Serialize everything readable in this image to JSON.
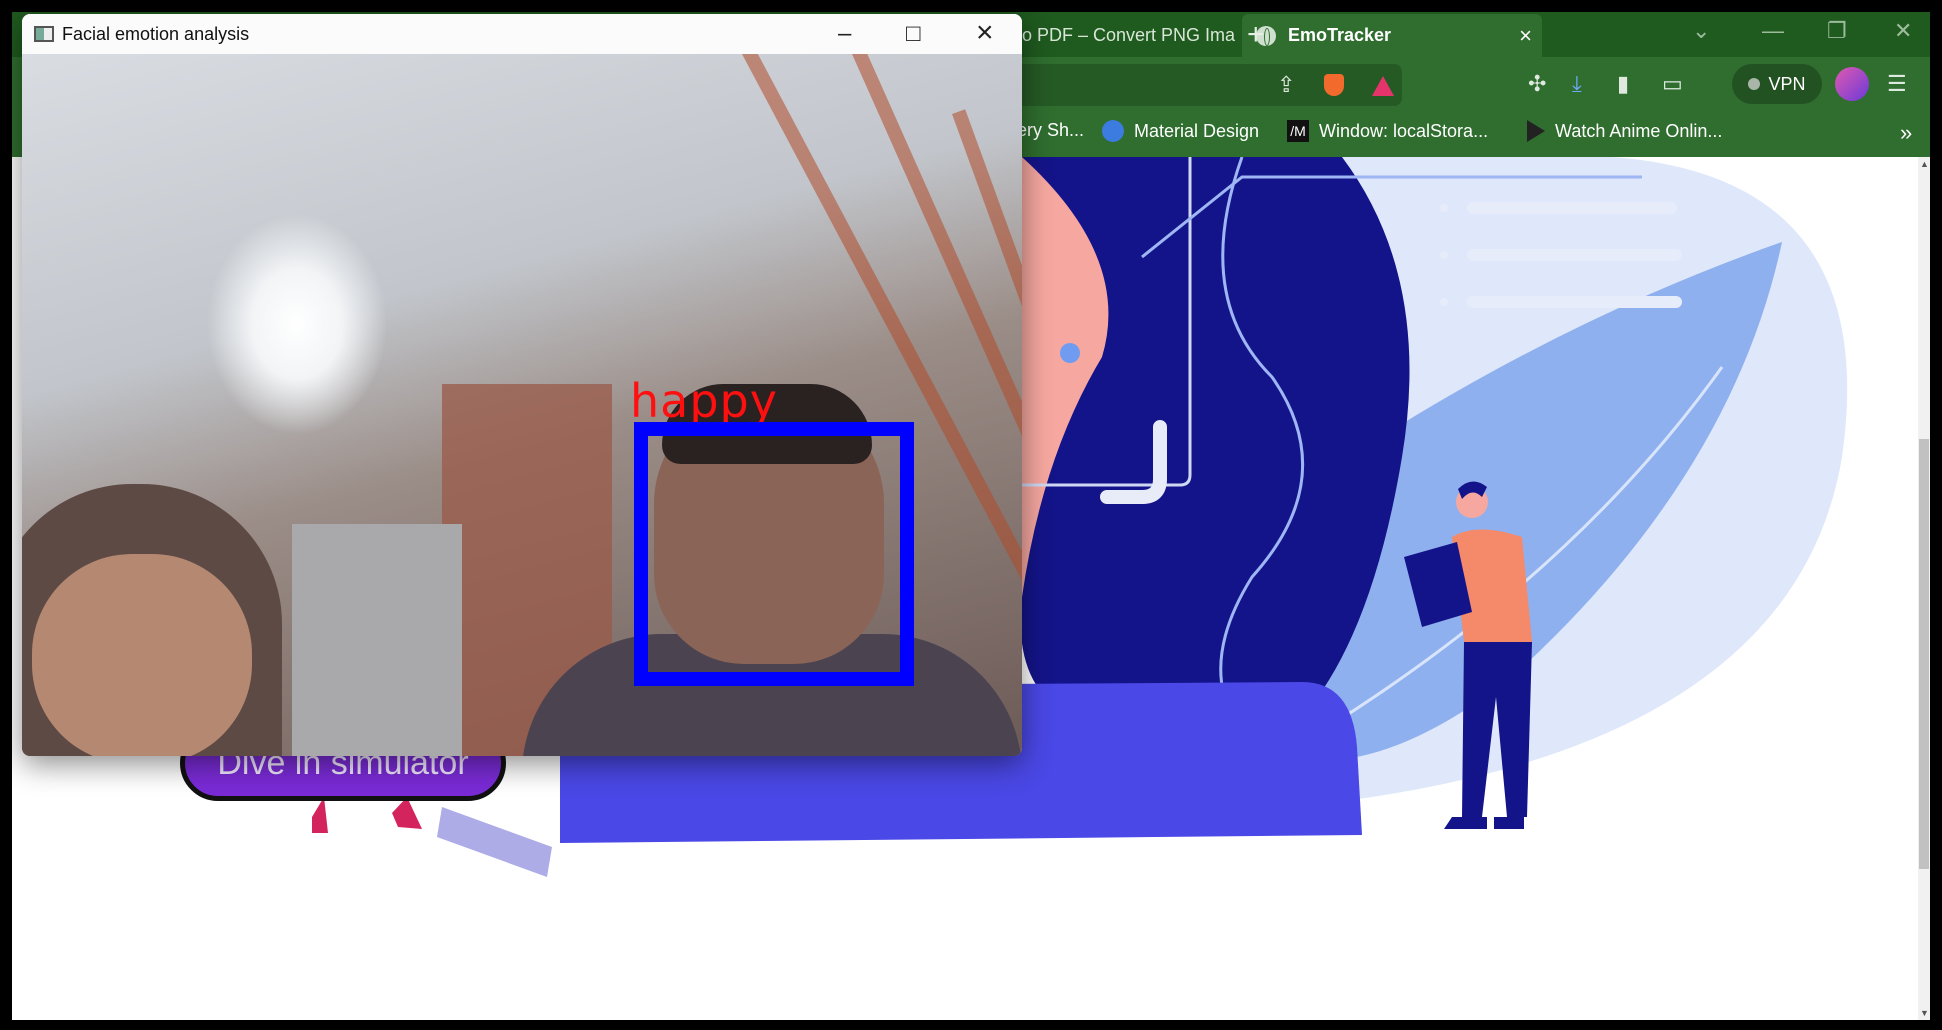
{
  "browser": {
    "tabs": [
      {
        "label": "o PDF – Convert PNG Ima",
        "active": false
      },
      {
        "label": "EmoTracker",
        "active": true
      }
    ],
    "new_tab": "+",
    "close_tab": "×",
    "vpn_label": "VPN",
    "bookmarks": [
      {
        "label": "ery Sh..."
      },
      {
        "label": "Material Design"
      },
      {
        "label": "Window: localStora..."
      },
      {
        "label": "Watch Anime Onlin..."
      }
    ],
    "bookmarks_more": "»"
  },
  "page": {
    "cta_button": "Dive in simulator"
  },
  "emotion_window": {
    "title": "Facial emotion analysis",
    "minimize": "–",
    "maximize": "□",
    "close": "×",
    "detection_label": "happy",
    "box_color": "#0000ff",
    "label_color": "#ff0000"
  },
  "colors": {
    "browser_frame": "#2f6e2f",
    "tabbar": "#1f5a1f",
    "illustration_navy": "#14148a",
    "illustration_blue": "#4a48e6",
    "illustration_light": "#b8cbf5"
  }
}
